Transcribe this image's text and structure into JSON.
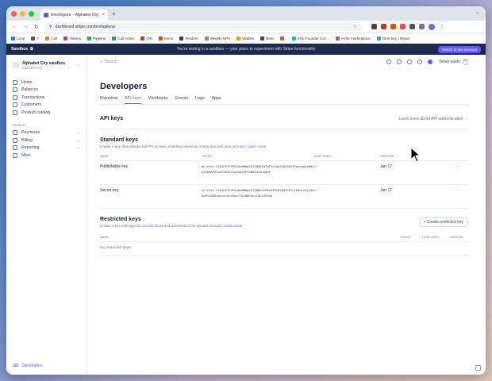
{
  "browser": {
    "tab_title": "Developers – Alphabet City sa...",
    "url": "dashboard.stripe.com/test/apikeys",
    "bookmarks": [
      "Loop",
      "Y",
      "Cult",
      "Tokens",
      "Pipeline",
      "Cult notes",
      "CRI",
      "Items",
      "Tenders",
      "Weekly NPA",
      "Stables",
      "Beta",
      "",
      "eTip Founder Circ...",
      "eVite marketplace",
      "Directory | Retail"
    ]
  },
  "banner": {
    "label": "Sandbox",
    "message": "You're testing in a sandbox — your place to experiment with Stripe functionality",
    "switch_button": "Switch to live account"
  },
  "sidebar": {
    "account_name": "Alphabet City sandbox",
    "account_sub": "Alphabet City",
    "items": [
      {
        "label": "Home"
      },
      {
        "label": "Balances"
      },
      {
        "label": "Transactions"
      },
      {
        "label": "Customers"
      },
      {
        "label": "Product catalog"
      }
    ],
    "products_title": "Products",
    "products": [
      {
        "label": "Payments"
      },
      {
        "label": "Billing"
      },
      {
        "label": "Reporting"
      },
      {
        "label": "More"
      }
    ],
    "developers_link": "Developers"
  },
  "topbar": {
    "search_placeholder": "Search",
    "setup_guide": "Setup guide"
  },
  "page": {
    "title": "Developers",
    "tabs": [
      "Overview",
      "API keys",
      "Webhooks",
      "Events",
      "Logs",
      "Apps"
    ],
    "active_tab": "API keys"
  },
  "api_keys": {
    "heading": "API keys",
    "learn_more": "Learn more about API authentication →",
    "standard": {
      "title": "Standard keys",
      "description": "Create a key that unlocks full API access, enabling extensive interaction with your account.",
      "learn_more": "Learn more",
      "columns": [
        "NAME",
        "TOKEN",
        "LAST USED",
        "CREATED"
      ],
      "rows": [
        {
          "name": "Publishable key",
          "token": "pk_test_51R4hP7FVPGuHzNMWpkEI1NHXIq7NT3cSwdtSQvRDJ2FbwrwOyeRNJpj3pMAFHtdJYXD3Vu1gbaG46PYXNRd4ZUn0gBF",
          "last_used": "—",
          "created": "Jun 17",
          "more": "···"
        },
        {
          "name": "Secret key",
          "token": "sk_test_51R4hP7FVPGuHzNMWpkEI1NHXXIEBeG3Ms0Sb9ZSS7urkRHrXsyjNHBwPlKAU8XqsxxcdtFbav7TqLNNPoaII8o1UPhdw",
          "last_used": "—",
          "created": "Jun 17",
          "more": "···"
        }
      ]
    },
    "restricted": {
      "title": "Restricted keys",
      "description": "Create a key with specific access limits and permissions for greater security.",
      "learn_more": "Learn more",
      "create_button": "+ Create restricted key",
      "columns": [
        "NAME",
        "TOKEN",
        "LAST USED",
        "CREATED"
      ],
      "empty": "No restricted keys"
    }
  },
  "colors": {
    "accent": "#635bff",
    "banner_bg": "#1a2b4c",
    "heading": "#1a1f36"
  }
}
